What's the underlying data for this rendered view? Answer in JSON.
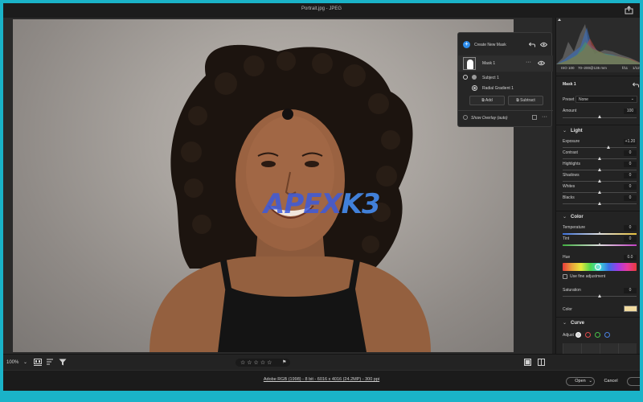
{
  "window": {
    "title": "Portrait.jpg  -  JPEG"
  },
  "mask_panel": {
    "create_label": "Create New Mask",
    "mask_name": "Mask 1",
    "components": [
      "Subject 1",
      "Radial Gradient 1"
    ],
    "add_label": "Add",
    "subtract_label": "Subtract",
    "show_overlay_label": "Show Overlay (auto)"
  },
  "histogram": {
    "info": [
      "ISO 100",
      "70–200@135 mm",
      "f/11",
      "1/12"
    ]
  },
  "mask_settings": {
    "title": "Mask 1",
    "preset_label": "Preset",
    "preset_value": "None",
    "amount_label": "Amount",
    "amount_value": "100",
    "amount_level": 0.5
  },
  "light": {
    "title": "Light",
    "sliders": [
      {
        "label": "Exposure",
        "value": "+1.20",
        "level": 0.62
      },
      {
        "label": "Contrast",
        "value": "0",
        "level": 0.5
      },
      {
        "label": "Highlights",
        "value": "0",
        "level": 0.5
      },
      {
        "label": "Shadows",
        "value": "0",
        "level": 0.5
      },
      {
        "label": "Whites",
        "value": "0",
        "level": 0.5
      },
      {
        "label": "Blacks",
        "value": "0",
        "level": 0.5
      }
    ]
  },
  "color": {
    "title": "Color",
    "temperature": {
      "label": "Temperature",
      "value": "0",
      "level": 0.5
    },
    "tint": {
      "label": "Tint",
      "value": "0",
      "level": 0.5
    },
    "hue": {
      "label": "Hue",
      "value": "0.0",
      "level": 0.48
    },
    "fine_adjust_label": "Use fine adjustment",
    "saturation": {
      "label": "Saturation",
      "value": "0",
      "level": 0.5
    },
    "color_label": "Color",
    "swatch": "#f2dca0"
  },
  "curve": {
    "title": "Curve",
    "adjust_label": "Adjust"
  },
  "bottombar": {
    "zoom": "100%",
    "stars": "☆☆☆☆☆"
  },
  "footer": {
    "file_info": "Adobe RGB (1998) - 8 bit - 6016 x 4016 (24.2MP) - 300 ppi",
    "open_label": "Open",
    "cancel_label": "Cancel"
  },
  "watermark": {
    "part1": "APEX",
    "part2": "K3"
  },
  "colors": {
    "accent": "#2d8ceb",
    "frame": "#1ab3c8"
  }
}
